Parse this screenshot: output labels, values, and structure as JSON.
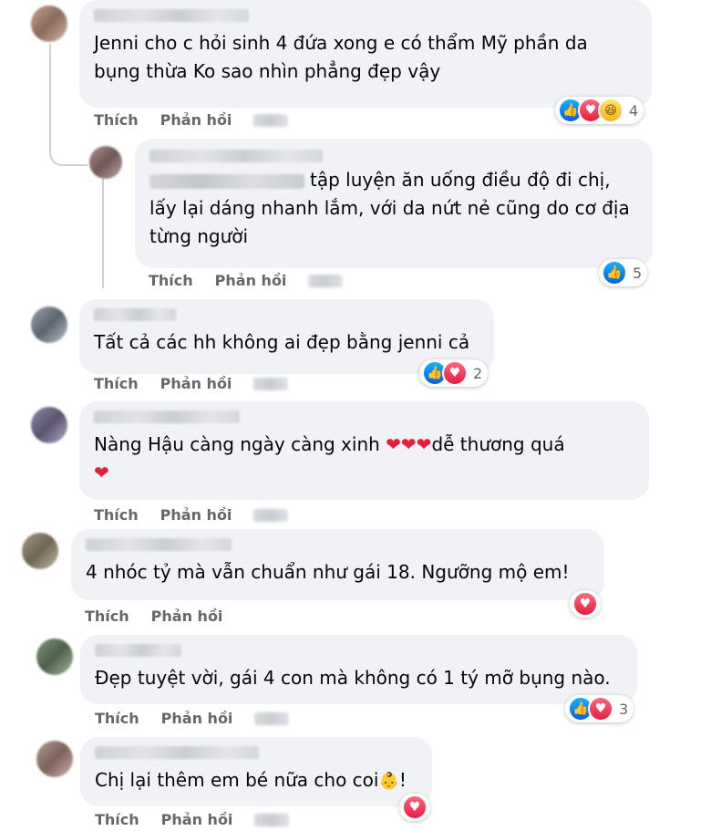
{
  "comments": [
    {
      "text": "Jenni cho c hỏi sinh 4 đứa xong e có thẩm Mỹ phần da bụng thừa Ko sao nhìn phẳng đẹp vậy",
      "like_label": "Thích",
      "reply_label": "Phản hồi",
      "reaction_count": "4",
      "reactions": [
        "like-icon",
        "love-icon",
        "haha-icon"
      ]
    },
    {
      "is_reply": true,
      "text": "tập luyện ăn uống điều độ đi chị, lấy lại dáng nhanh lắm, với da nứt nẻ cũng do cơ địa từng người",
      "like_label": "Thích",
      "reply_label": "Phản hồi",
      "reaction_count": "5",
      "reactions": [
        "like-icon"
      ]
    },
    {
      "text": "Tất cả các hh không ai đẹp bằng jenni cả",
      "like_label": "Thích",
      "reply_label": "Phản hồi",
      "reaction_count": "2",
      "reactions": [
        "like-icon",
        "love-icon"
      ]
    },
    {
      "text_before": "Nàng Hậu càng ngày càng xinh ",
      "hearts": "❤❤❤",
      "text_after": "dễ thương quá",
      "heart_line2": "❤",
      "like_label": "Thích",
      "reply_label": "Phản hồi"
    },
    {
      "text": "4 nhóc tỷ mà vẫn chuẩn như gái 18. Ngưỡng mộ em!",
      "like_label": "Thích",
      "reply_label": "Phản hồi",
      "reactions": [
        "love-icon"
      ]
    },
    {
      "text": "Đẹp tuyệt vời, gái 4 con mà không có 1 tý mỡ bụng nào.",
      "like_label": "Thích",
      "reply_label": "Phản hồi",
      "reaction_count": "3",
      "reactions": [
        "like-icon",
        "love-icon"
      ]
    },
    {
      "text": "Chị lại thêm em bé nữa cho coi",
      "emoji": "👶",
      "text_end": "!",
      "like_label": "Thích",
      "reply_label": "Phản hồi",
      "reactions": [
        "love-icon"
      ]
    }
  ],
  "colors": {
    "bubble": "#f0f2f5",
    "action_text": "#65676b",
    "like": "#1877f2",
    "love": "#f33e58"
  }
}
